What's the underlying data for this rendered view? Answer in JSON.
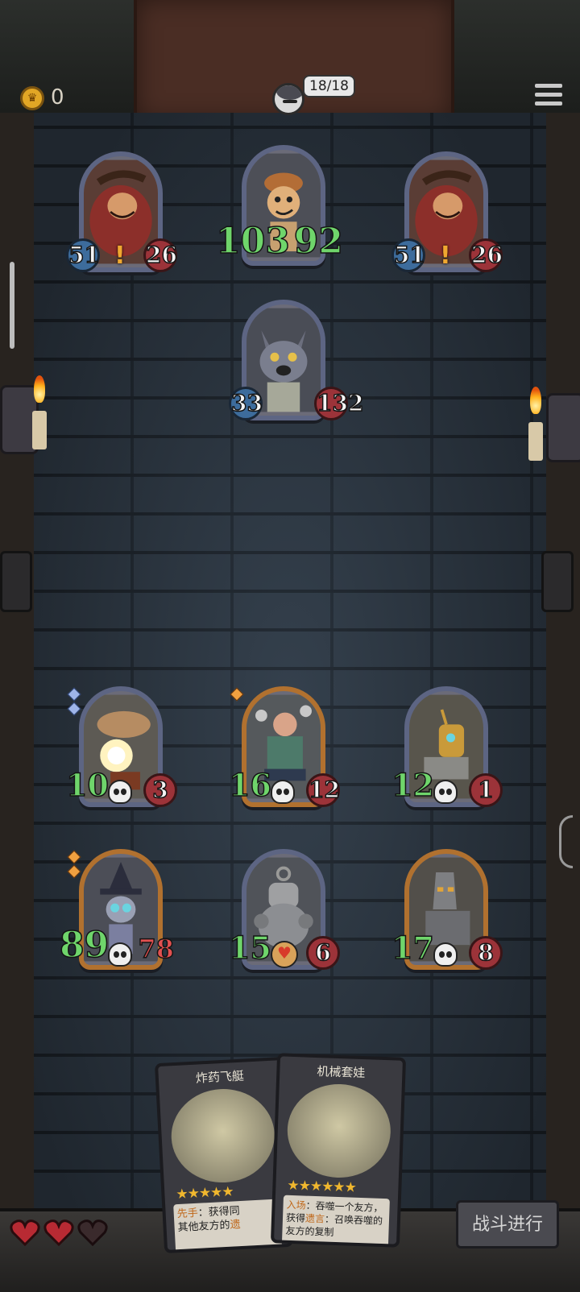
{
  "hud": {
    "coins": "0",
    "deck_counter": "18/18",
    "menu_icon": "hamburger-menu-icon"
  },
  "colors": {
    "attack_green": "#6fd56b",
    "health_red": "#e25050",
    "badge_blue": "#3d6c9c",
    "badge_red": "#9c3339",
    "coin_gold": "#e2a625"
  },
  "enemies": [
    {
      "name_hint": "red-mane-lion-beast",
      "attack": "51",
      "health": "26",
      "alert": "!"
    },
    {
      "name_hint": "goblin-scout",
      "attack": "103",
      "health": "92"
    },
    {
      "name_hint": "red-mane-lion-beast",
      "attack": "51",
      "health": "26",
      "alert": "!"
    },
    {
      "name_hint": "grey-wolf",
      "attack": "33",
      "health": "132"
    }
  ],
  "allies": [
    {
      "name_hint": "bomb-airship",
      "attack": "10",
      "health": "3"
    },
    {
      "name_hint": "brawler",
      "attack": "16",
      "health": "12"
    },
    {
      "name_hint": "clockwork-robot",
      "attack": "12",
      "health": "1"
    },
    {
      "name_hint": "witch-rabbit",
      "attack": "89",
      "health": "78"
    },
    {
      "name_hint": "wind-up-robot",
      "attack": "15",
      "health": "6"
    },
    {
      "name_hint": "iron-golem",
      "attack": "17",
      "health": "8"
    }
  ],
  "hand": [
    {
      "title": "炸药飞艇",
      "stars": "★★★★★",
      "keyword1": "先手",
      "text1": "：获得同",
      "text2": "其他友方的",
      "keyword2": "遗"
    },
    {
      "title": "机械套娃",
      "stars": "★★★★★★",
      "keyword1": "入场",
      "text1": "：吞噬一个友方，",
      "text2": "获得",
      "keyword2": "遗言",
      "text3": "：召唤吞噬的",
      "text4": "友方的复制"
    }
  ],
  "lives": 3,
  "battle_button": "战斗进行"
}
